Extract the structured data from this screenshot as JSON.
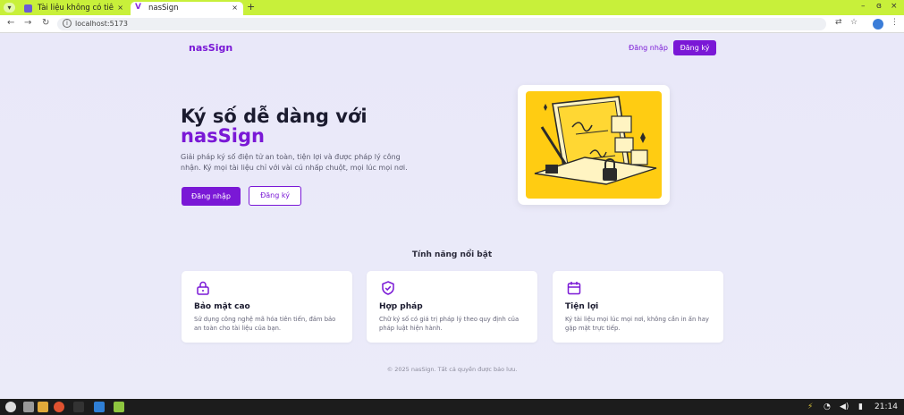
{
  "browser": {
    "tabs": [
      {
        "title": "Tài liệu không có tiê",
        "active": false
      },
      {
        "title": "nasSign",
        "active": true
      }
    ],
    "new_tab": "+",
    "url": "localhost:5173",
    "window_controls": {
      "minimize": "–",
      "restore": "ɞ",
      "close": "×"
    }
  },
  "header": {
    "logo": "nasSign",
    "login_label": "Đăng nhập",
    "register_label": "Đăng ký"
  },
  "hero": {
    "title": "Ký số dễ dàng với",
    "brand": "nasSign",
    "description": "Giải pháp ký số điện tử an toàn, tiện lợi và được pháp lý công nhận. Ký mọi tài liệu chỉ với vài cú nhấp chuột, mọi lúc mọi nơi.",
    "login_label": "Đăng nhập",
    "register_label": "Đăng ký"
  },
  "features": {
    "title": "Tính năng nổi bật",
    "items": [
      {
        "title": "Bảo mật cao",
        "description": "Sử dụng công nghệ mã hóa tiên tiến, đảm bảo an toàn cho tài liệu của bạn.",
        "icon": "lock-icon"
      },
      {
        "title": "Hợp pháp",
        "description": "Chữ ký số có giá trị pháp lý theo quy định của pháp luật hiện hành.",
        "icon": "shield-check-icon"
      },
      {
        "title": "Tiện lợi",
        "description": "Ký tài liệu mọi lúc mọi nơi, không cần in ấn hay gặp mặt trực tiếp.",
        "icon": "calendar-icon"
      }
    ]
  },
  "footer": {
    "text": "© 2025 nasSign. Tất cả quyền được bảo lưu."
  },
  "taskbar": {
    "clock": "21:14"
  },
  "colors": {
    "brand": "#7a18d6",
    "illustration_bg": "#ffcc12",
    "tabbar": "#c8f03a"
  }
}
